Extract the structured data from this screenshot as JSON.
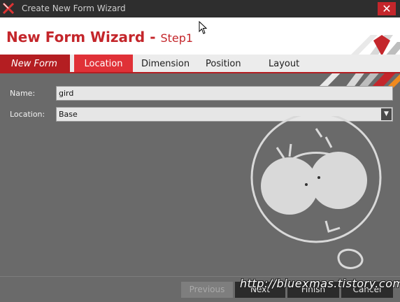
{
  "window": {
    "title": "Create New Form Wizard",
    "close_label": "✕"
  },
  "header": {
    "title": "New Form Wizard - ",
    "step": "Step1"
  },
  "tabs": [
    {
      "label": "New Form"
    },
    {
      "label": "Location"
    },
    {
      "label": "Dimension"
    },
    {
      "label": "Position"
    },
    {
      "label": "Layout"
    }
  ],
  "form": {
    "name_label": "Name:",
    "name_value": "gird",
    "location_label": "Location:",
    "location_value": "Base",
    "dropdown_glyph": "▼"
  },
  "buttons": {
    "previous": "Previous",
    "next": "Next",
    "finish": "Finish",
    "cancel": "Cancel"
  },
  "watermark": {
    "url": "http://bluexmas.tistory.com/"
  },
  "colors": {
    "accent": "#c4262b",
    "tab_active": "#e03137",
    "tab_first": "#b41e22"
  }
}
